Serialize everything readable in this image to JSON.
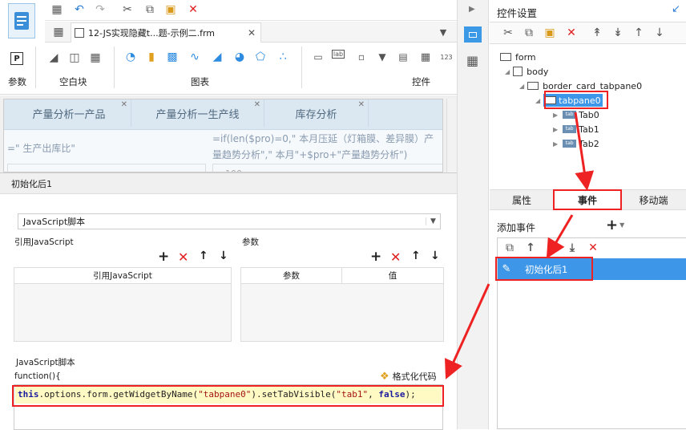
{
  "file_tab": {
    "label": "12-JS实现隐藏t...题-示例二.frm"
  },
  "ribbon": {
    "groups": [
      {
        "label": "参数"
      },
      {
        "label": "空白块"
      },
      {
        "label": "图表"
      },
      {
        "label": "控件"
      }
    ]
  },
  "canvas": {
    "tabs": [
      "产量分析一产品",
      "产量分析一生产线",
      "库存分析"
    ],
    "formula_left": "=\" 生产出库比\"",
    "formula_right_1": "=if(len($pro)=0,\" 本月压延（灯箱膜、差异膜）产",
    "formula_right_2": "量趋势分析\",\" 本月\"+$pro+\"产量趋势分析\")",
    "axis_value": "100"
  },
  "dialog": {
    "title": "初始化后1",
    "select_value": "JavaScript脚本",
    "ref_js_label": "引用JavaScript",
    "params_label": "参数",
    "ref_js_col": "引用JavaScript",
    "params_col": "参数",
    "value_col": "值",
    "script_label": "JavaScript脚本",
    "func_head": "function(){",
    "format_btn": "格式化代码",
    "code": {
      "kw_this": "this",
      "part1": ".options.form.getWidgetByName(",
      "str1": "\"tabpane0\"",
      "part2": ").setTabVisible(",
      "str2": "\"tab1\"",
      "comma": ", ",
      "kw_false": "false",
      "end": ");"
    }
  },
  "right_panel": {
    "title": "控件设置",
    "tree": {
      "form": "form",
      "body": "body",
      "border": "border_card_tabpane0",
      "tabpane": "tabpane0",
      "tab0": "Tab0",
      "tab1": "Tab1",
      "tab2": "Tab2"
    },
    "tabs": [
      "属性",
      "事件",
      "移动端"
    ],
    "add_event_label": "添加事件",
    "event_item": "初始化后1",
    "tab_icon_text": "tab"
  },
  "colors": {
    "accent": "#3b99e6",
    "highlight": "#e22222",
    "selected": "#3d96e8"
  }
}
